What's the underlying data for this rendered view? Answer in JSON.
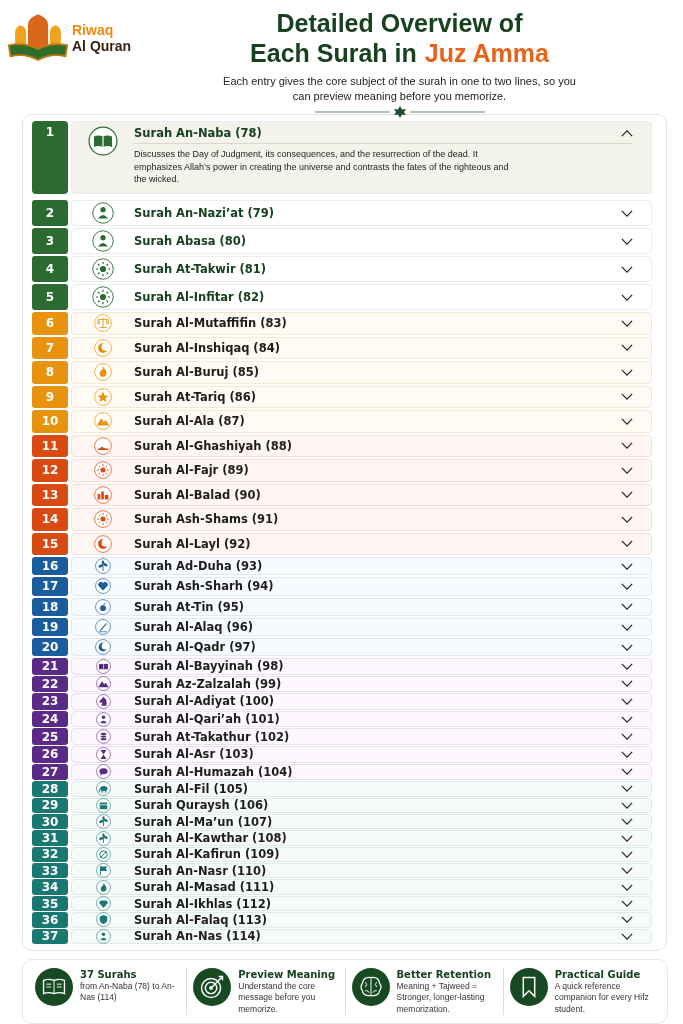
{
  "brand": {
    "line1": "Riwaq",
    "line2": "Al Quran"
  },
  "title": {
    "line1": "Detailed Overview of",
    "line2": "Each Surah in",
    "highlight": "Juz Amma"
  },
  "subtitle": "Each entry gives the core subject of the surah in one to two lines, so you can preview meaning before you memorize.",
  "groups": [
    {
      "color": "#2b6a31",
      "items": [
        {
          "number": "1",
          "title": "Surah An-Naba (78)",
          "expanded": true,
          "description": "Discusses the Day of Judgment, its consequences, and the resurrection of the dead. It emphasizes Allah’s power in creating the universe and contrasts the fates of the righteous and the wicked."
        },
        {
          "number": "2",
          "title": "Surah An-Nazi’at (79)",
          "expanded": false
        },
        {
          "number": "3",
          "title": "Surah Abasa (80)",
          "expanded": false
        },
        {
          "number": "4",
          "title": "Surah At-Takwir (81)",
          "expanded": false
        },
        {
          "number": "5",
          "title": "Surah Al-Infitar (82)",
          "expanded": false
        }
      ]
    },
    {
      "color": "#e8930e",
      "items": [
        {
          "number": "6",
          "title": "Surah Al-Mutaffifin (83)",
          "expanded": false
        },
        {
          "number": "7",
          "title": "Surah Al-Inshiqaq (84)",
          "expanded": false
        },
        {
          "number": "8",
          "title": "Surah Al-Buruj (85)",
          "expanded": false
        },
        {
          "number": "9",
          "title": "Surah At-Tariq (86)",
          "expanded": false
        },
        {
          "number": "10",
          "title": "Surah Al-Ala (87)",
          "expanded": false
        }
      ]
    },
    {
      "color": "#d94a12",
      "items": [
        {
          "number": "11",
          "title": "Surah Al-Ghashiyah (88)",
          "expanded": false
        },
        {
          "number": "12",
          "title": "Surah Al-Fajr (89)",
          "expanded": false
        },
        {
          "number": "13",
          "title": "Surah Al-Balad (90)",
          "expanded": false
        },
        {
          "number": "14",
          "title": "Surah Ash-Shams (91)",
          "expanded": false
        },
        {
          "number": "15",
          "title": "Surah Al-Layl (92)",
          "expanded": false
        }
      ]
    },
    {
      "color": "#1b5d9c",
      "items": [
        {
          "number": "16",
          "title": "Surah Ad-Duha (93)",
          "expanded": false
        },
        {
          "number": "17",
          "title": "Surah Ash-Sharh (94)",
          "expanded": false
        },
        {
          "number": "18",
          "title": "Surah At-Tin (95)",
          "expanded": false
        },
        {
          "number": "19",
          "title": "Surah Al-Alaq (96)",
          "expanded": false
        },
        {
          "number": "20",
          "title": "Surah Al-Qadr (97)",
          "expanded": false
        }
      ]
    },
    {
      "color": "#5a2a86",
      "items": [
        {
          "number": "21",
          "title": "Surah Al-Bayyinah (98)",
          "expanded": false
        },
        {
          "number": "22",
          "title": "Surah Az-Zalzalah (99)",
          "expanded": false
        },
        {
          "number": "23",
          "title": "Surah Al-Adiyat (100)",
          "expanded": false
        },
        {
          "number": "24",
          "title": "Surah Al-Qari’ah (101)",
          "expanded": false
        },
        {
          "number": "25",
          "title": "Surah At-Takathur (102)",
          "expanded": false
        },
        {
          "number": "26",
          "title": "Surah Al-Asr (103)",
          "expanded": false
        },
        {
          "number": "27",
          "title": "Surah Al-Humazah (104)",
          "expanded": false
        }
      ]
    },
    {
      "color": "#1a7873",
      "items": [
        {
          "number": "28",
          "title": "Surah Al-Fil (105)",
          "expanded": false
        },
        {
          "number": "29",
          "title": "Surah Quraysh (106)",
          "expanded": false
        },
        {
          "number": "30",
          "title": "Surah Al-Ma’un (107)",
          "expanded": false
        },
        {
          "number": "31",
          "title": "Surah Al-Kawthar (108)",
          "expanded": false
        },
        {
          "number": "32",
          "title": "Surah Al-Kafirun (109)",
          "expanded": false
        },
        {
          "number": "33",
          "title": "Surah An-Nasr (110)",
          "expanded": false
        },
        {
          "number": "34",
          "title": "Surah Al-Masad (111)",
          "expanded": false
        },
        {
          "number": "35",
          "title": "Surah Al-Ikhlas (112)",
          "expanded": false
        },
        {
          "number": "36",
          "title": "Surah Al-Falaq (113)",
          "expanded": false
        },
        {
          "number": "37",
          "title": "Surah An-Nas (114)",
          "expanded": false
        }
      ]
    }
  ],
  "features": [
    {
      "title": "37 Surahs",
      "text": "from An-Naba (78) to An-Nas (114)"
    },
    {
      "title": "Preview Meaning",
      "text": "Understand the core message before you memorize."
    },
    {
      "title": "Better Retention",
      "text": "Meaning + Tajweed = Stronger, longer-lasting memorization."
    },
    {
      "title": "Practical Guide",
      "text": "A quick reference companion for every Hifz student."
    }
  ]
}
